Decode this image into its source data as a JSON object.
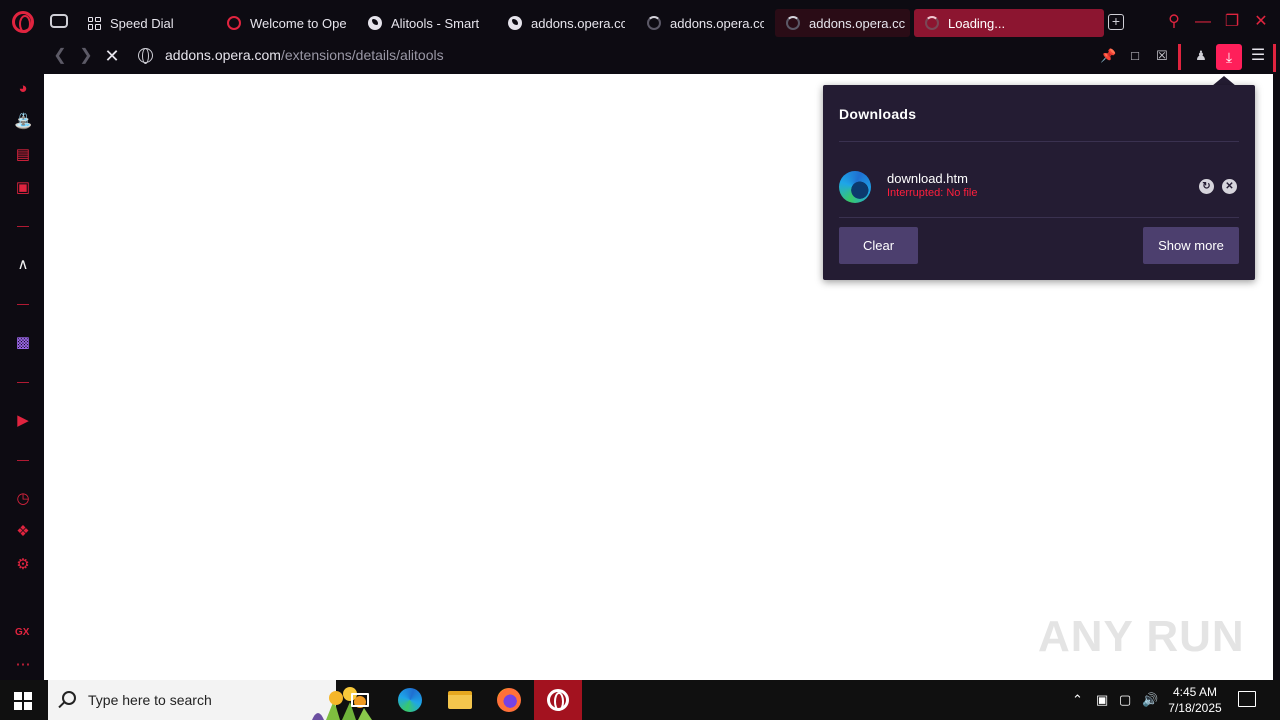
{
  "tabs": [
    {
      "title": "Speed Dial",
      "icon": "speed-dial-icon"
    },
    {
      "title": "Welcome to Ope",
      "icon": "opera-icon"
    },
    {
      "title": "Alitools - Smart",
      "icon": "globe-icon"
    },
    {
      "title": "addons.opera.cc",
      "icon": "globe-icon"
    },
    {
      "title": "addons.opera.cc",
      "icon": "loading-icon"
    },
    {
      "title": "addons.opera.cc",
      "icon": "loading-icon"
    },
    {
      "title": "Loading...",
      "icon": "loading-icon"
    }
  ],
  "address": {
    "host": "addons.opera.com",
    "path": "/extensions/details/alitools"
  },
  "downloads": {
    "title": "Downloads",
    "items": [
      {
        "filename": "download.htm",
        "status": "Interrupted: No file",
        "icon": "edge-file-icon"
      }
    ],
    "clear_label": "Clear",
    "show_more_label": "Show more"
  },
  "watermark": "ANY RUN",
  "sidebar": {
    "gx_label": "GX",
    "icons": [
      "speedometer-icon",
      "bag-icon",
      "player-icon",
      "messenger-icon",
      "aria-icon",
      "twitch-icon",
      "music-icon",
      "history-icon",
      "extensions-icon",
      "settings-icon",
      "more-icon"
    ]
  },
  "taskbar": {
    "search_placeholder": "Type here to search",
    "time": "4:45 AM",
    "date": "7/18/2025"
  },
  "colors": {
    "accent": "#e0243f",
    "download_button": "#ff1f5a",
    "popup_bg": "#241c33",
    "popup_button": "#4c3f6e",
    "error_text": "#ff1f3d"
  }
}
